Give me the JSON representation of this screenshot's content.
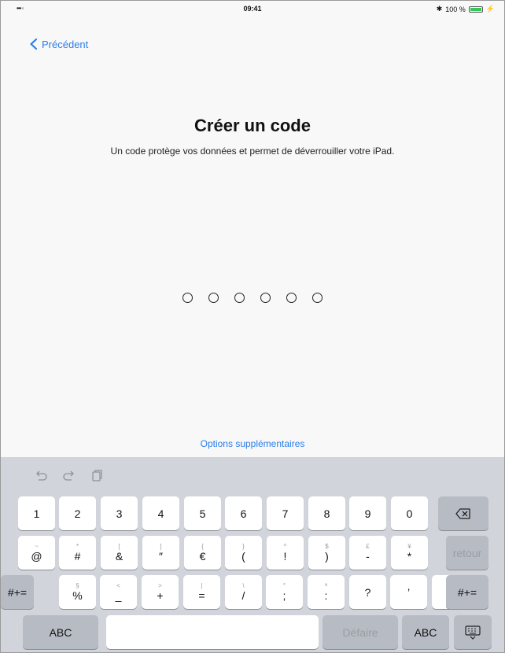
{
  "status_bar": {
    "signal": "••• ◦",
    "time": "09:41",
    "bluetooth": "✱",
    "battery_percent": "100 %",
    "charging": "⚡"
  },
  "nav": {
    "back_label": "Précédent"
  },
  "screen": {
    "title": "Créer un code",
    "subtitle": "Un code protège vos données et permet de déverrouiller votre iPad.",
    "passcode_length": 6,
    "options_link": "Options supplémentaires"
  },
  "keyboard": {
    "toolbar_icons": [
      "undo-icon",
      "redo-icon",
      "paste-icon"
    ],
    "row1": [
      {
        "main": "1"
      },
      {
        "main": "2"
      },
      {
        "main": "3"
      },
      {
        "main": "4"
      },
      {
        "main": "5"
      },
      {
        "main": "6"
      },
      {
        "main": "7"
      },
      {
        "main": "8"
      },
      {
        "main": "9"
      },
      {
        "main": "0"
      }
    ],
    "row2": [
      {
        "hint": "~",
        "main": "@"
      },
      {
        "hint": "*",
        "main": "#"
      },
      {
        "hint": "[",
        "main": "&"
      },
      {
        "hint": "]",
        "main": "″"
      },
      {
        "hint": "{",
        "main": "€"
      },
      {
        "hint": "}",
        "main": "("
      },
      {
        "hint": "^",
        "main": "!"
      },
      {
        "hint": "$",
        "main": ")"
      },
      {
        "hint": "£",
        "main": "-"
      },
      {
        "hint": "¥",
        "main": "*"
      }
    ],
    "row3": [
      {
        "hint": "§",
        "main": "%"
      },
      {
        "hint": "<",
        "main": "_"
      },
      {
        "hint": ">",
        "main": "+"
      },
      {
        "hint": "|",
        "main": "="
      },
      {
        "hint": "\\",
        "main": "/"
      },
      {
        "hint": "°",
        "main": ";"
      },
      {
        "hint": "ª",
        "main": ":"
      },
      {
        "hint": "",
        "main": "?"
      },
      {
        "hint": "",
        "main": "’"
      },
      {
        "hint": "",
        "main": "."
      }
    ],
    "return_label": "retour",
    "shift_left": "#+=",
    "shift_right": "#+=",
    "abc_left": "ABC",
    "abc_right": "ABC",
    "undo_label": "Défaire",
    "delete_icon": "delete-backspace-icon",
    "dismiss_icon": "keyboard-dismiss-icon"
  }
}
